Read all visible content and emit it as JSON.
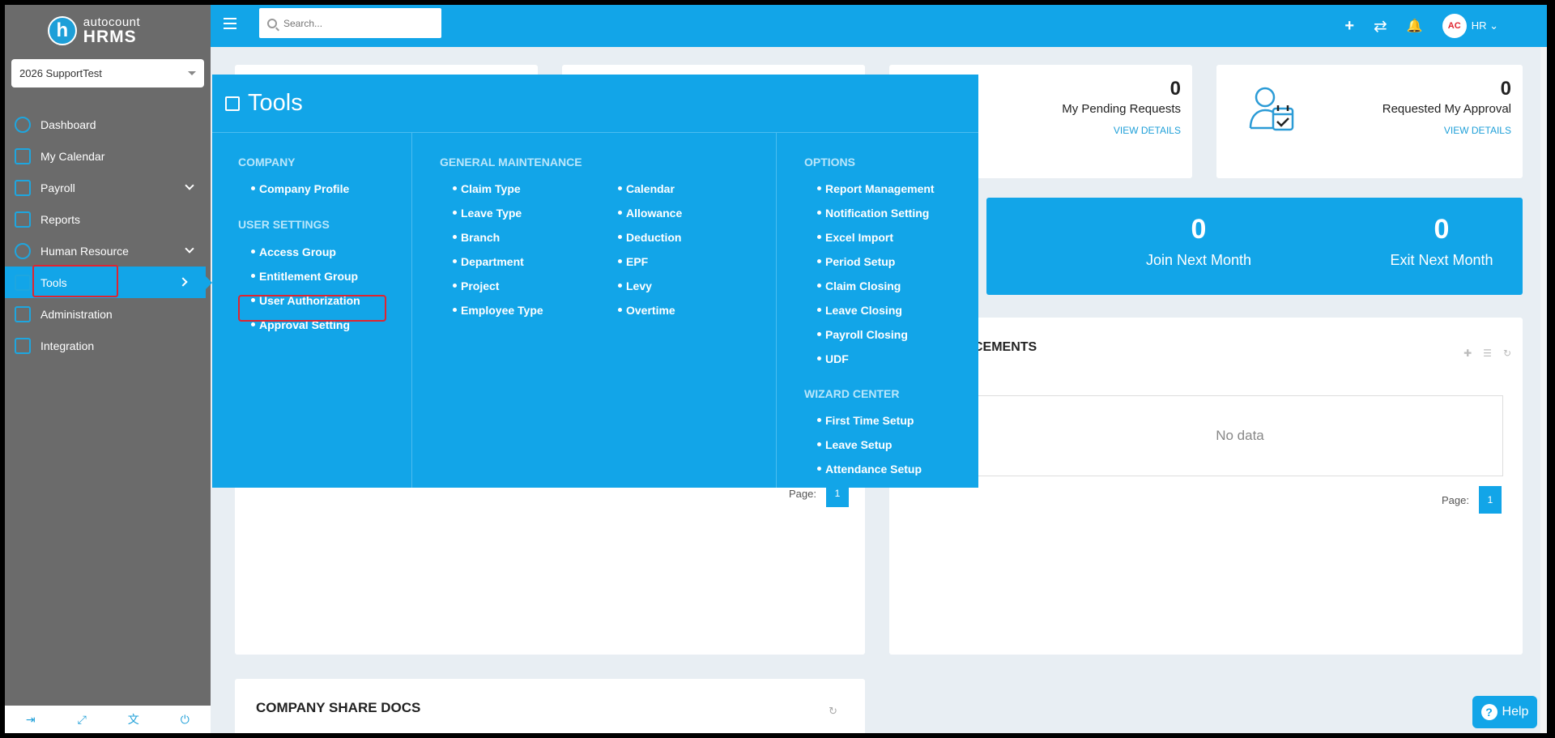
{
  "brand": {
    "logo_letter": "h",
    "line1": "autocount",
    "line2": "HRMS"
  },
  "company_select": {
    "value": "2026 SupportTest"
  },
  "sidebar": {
    "items": [
      {
        "label": "Dashboard"
      },
      {
        "label": "My Calendar"
      },
      {
        "label": "Payroll"
      },
      {
        "label": "Reports"
      },
      {
        "label": "Human Resource"
      },
      {
        "label": "Tools"
      },
      {
        "label": "Administration"
      },
      {
        "label": "Integration"
      }
    ]
  },
  "topbar": {
    "search_placeholder": "Search...",
    "user": "HR",
    "avatar_text": "AC"
  },
  "stats": {
    "pending": {
      "value": "0",
      "label": "My Pending Requests",
      "link": "VIEW DETAILS"
    },
    "approval": {
      "value": "0",
      "label": "Requested My Approval",
      "link": "VIEW DETAILS"
    }
  },
  "banner": {
    "join": {
      "value": "0",
      "label": "Join Next Month"
    },
    "exit": {
      "value": "0",
      "label": "Exit Next Month"
    }
  },
  "announcements": {
    "title": "CEMENTS",
    "empty": "No data",
    "page_label": "Page:",
    "page": "1"
  },
  "left_panel": {
    "page_label": "Page:",
    "page": "1"
  },
  "docs": {
    "title": "COMPANY SHARE DOCS"
  },
  "help": {
    "label": "Help",
    "glyph": "?"
  },
  "mega": {
    "title": "Tools",
    "company": {
      "heading": "COMPANY",
      "items": [
        "Company Profile"
      ]
    },
    "user_settings": {
      "heading": "USER SETTINGS",
      "items": [
        "Access Group",
        "Entitlement Group",
        "User Authorization",
        "Approval Setting"
      ]
    },
    "general": {
      "heading": "GENERAL MAINTENANCE",
      "col1": [
        "Claim Type",
        "Leave Type",
        "Branch",
        "Department",
        "Project",
        "Employee Type"
      ],
      "col2": [
        "Calendar",
        "Allowance",
        "Deduction",
        "EPF",
        "Levy",
        "Overtime"
      ]
    },
    "options": {
      "heading": "OPTIONS",
      "items": [
        "Report Management",
        "Notification Setting",
        "Excel Import",
        "Period Setup",
        "Claim Closing",
        "Leave Closing",
        "Payroll Closing",
        "UDF"
      ]
    },
    "wizard": {
      "heading": "WIZARD CENTER",
      "items": [
        "First Time Setup",
        "Leave Setup",
        "Attendance Setup"
      ]
    }
  },
  "colors": {
    "accent": "#12a5e8",
    "sidebar": "#6b6b6b",
    "highlight": "#e0242f"
  }
}
